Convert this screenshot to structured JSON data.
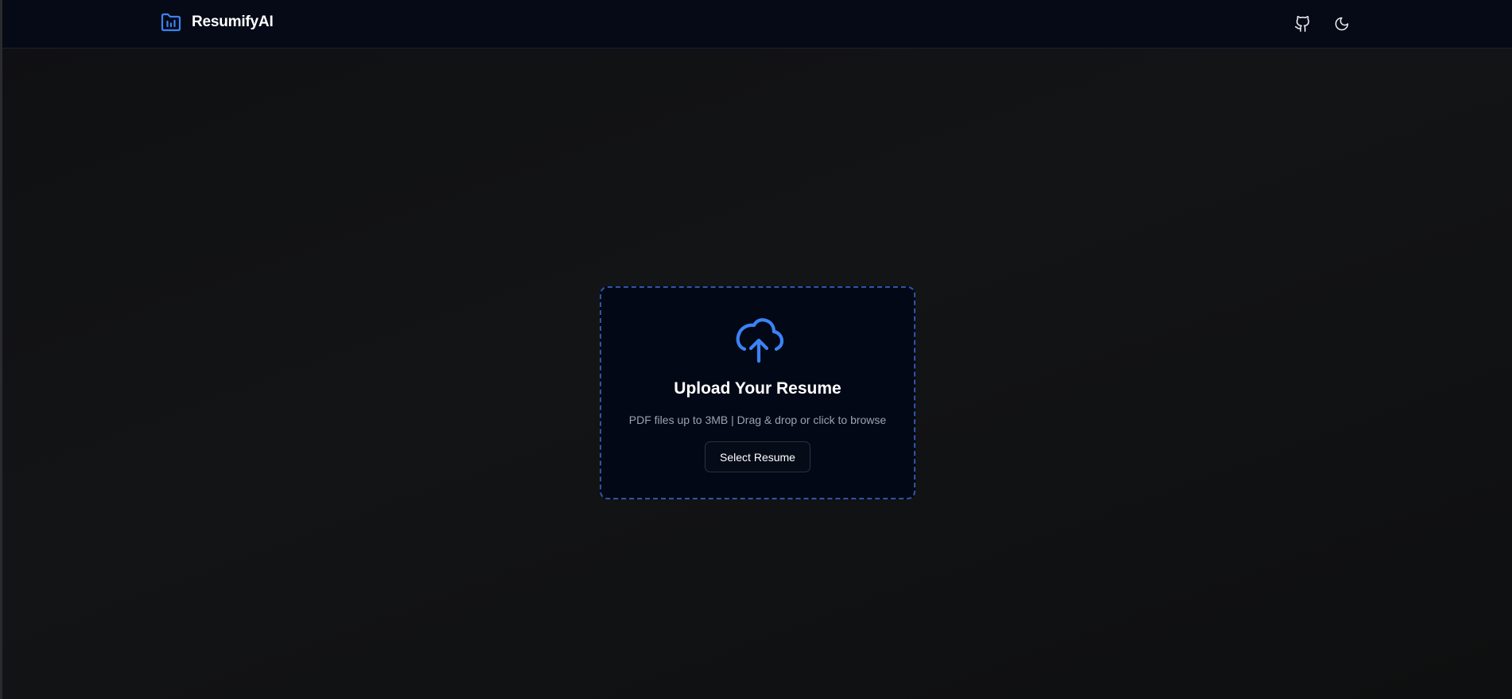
{
  "app": {
    "name": "ResumifyAI",
    "logo_icon": "folder-chart-icon"
  },
  "header": {
    "actions": [
      {
        "id": "github",
        "icon": "github-icon"
      },
      {
        "id": "theme",
        "icon": "moon-icon"
      }
    ]
  },
  "upload": {
    "icon": "cloud-upload-icon",
    "title": "Upload Your Resume",
    "hint": "PDF files up to 3MB | Drag & drop or click to browse",
    "button_label": "Select Resume"
  },
  "colors": {
    "accent": "#3b82f6",
    "header_bg": "#060a16",
    "card_bg": "#030816",
    "dashed_border": "#2c56a8"
  }
}
